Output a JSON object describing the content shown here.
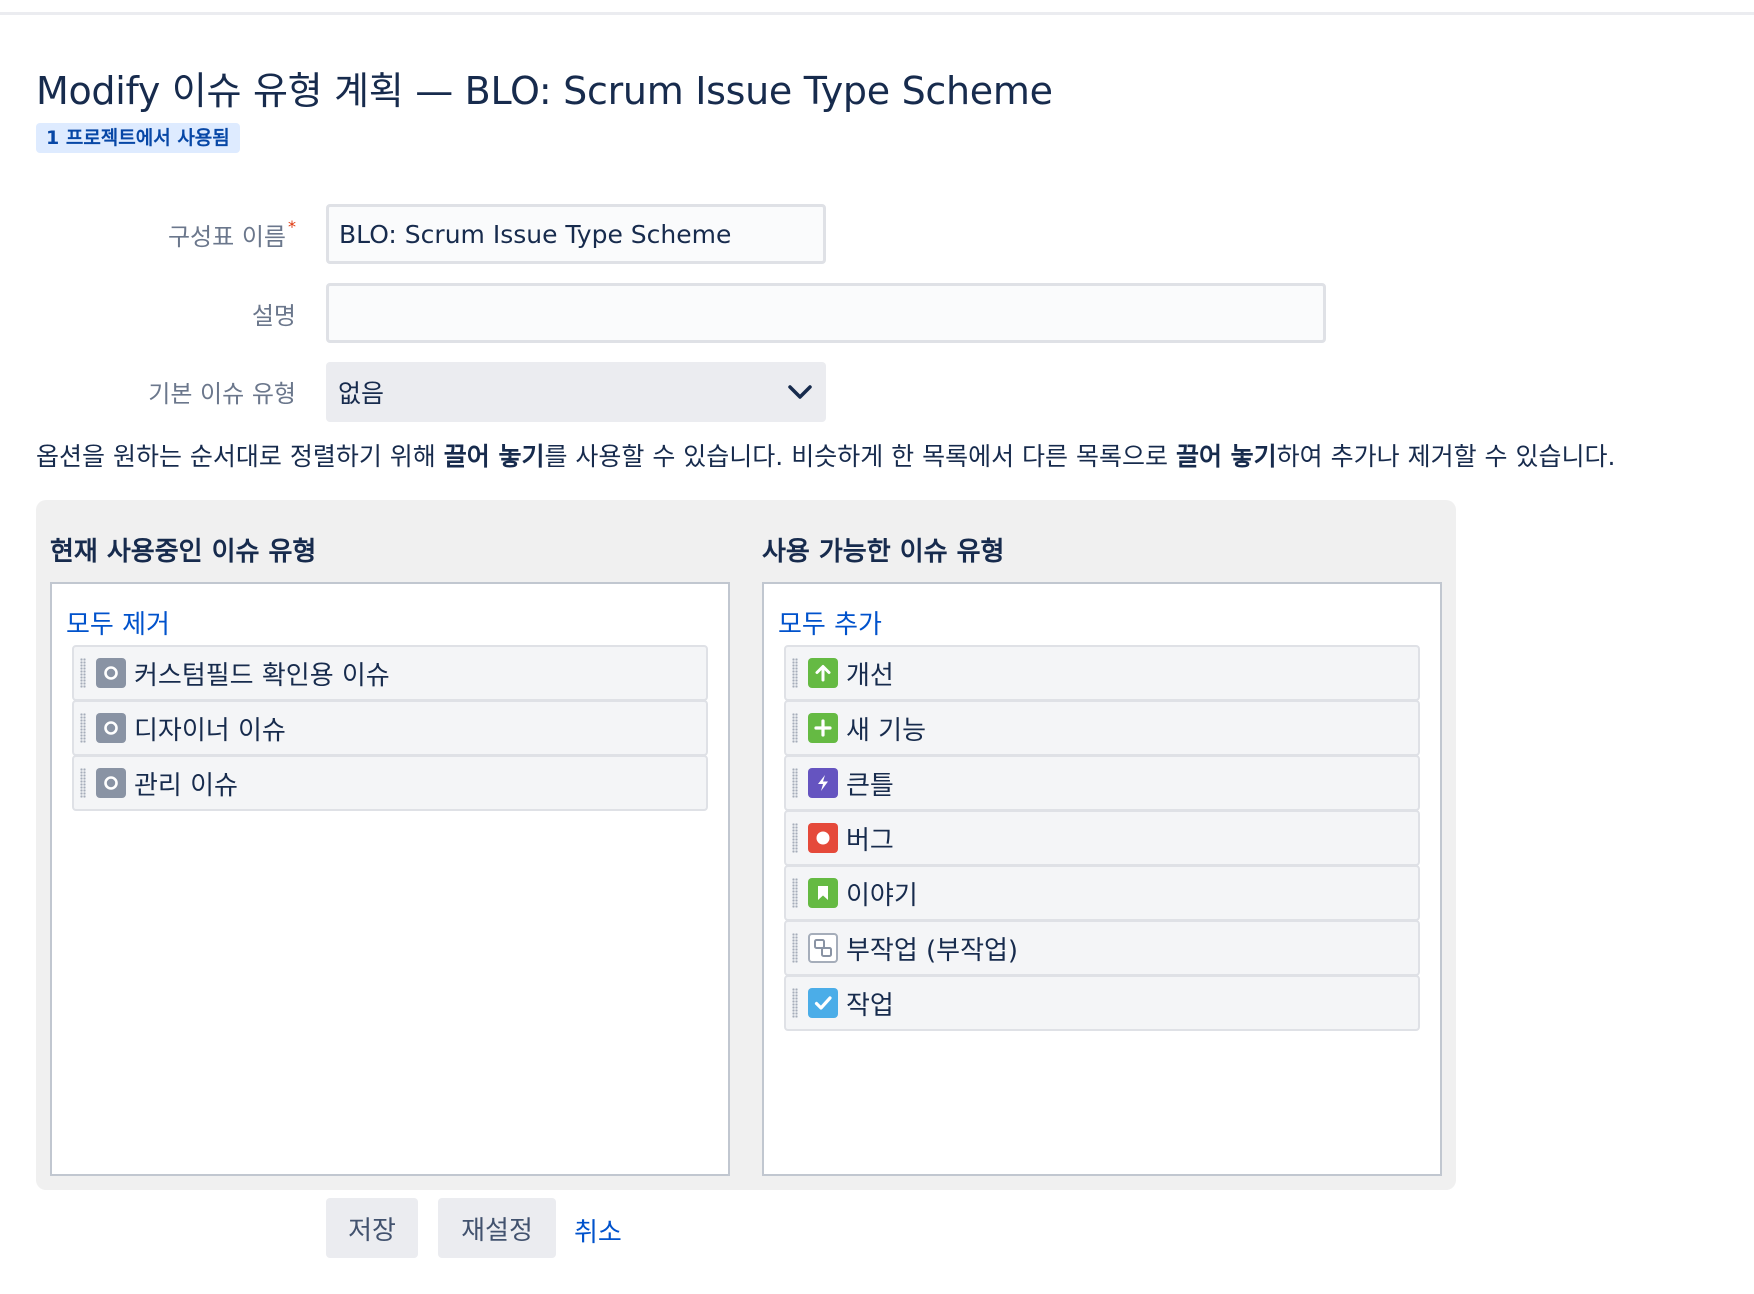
{
  "page": {
    "title": "Modify 이슈 유형 계획 — BLO: Scrum Issue Type Scheme",
    "usage_badge": "1 프로젝트에서 사용됨"
  },
  "form": {
    "scheme_name_label": "구성표 이름",
    "required_marker": "*",
    "scheme_name_value": "BLO: Scrum Issue Type Scheme",
    "description_label": "설명",
    "description_value": "",
    "default_type_label": "기본 이슈 유형",
    "default_type_value": "없음"
  },
  "help": {
    "part1": "옵션을 원하는 순서대로 정렬하기 위해 ",
    "bold1": "끌어 놓기",
    "part2": "를 사용할 수 있습니다. 비슷하게 한 목록에서 다른 목록으로 ",
    "bold2": "끌어 놓기",
    "part3": "하여 추가나 제거할 수 있습니다."
  },
  "current": {
    "title": "현재 사용중인 이슈 유형",
    "action": "모두 제거",
    "items": [
      {
        "label": "커스텀필드 확인용 이슈",
        "icon": "generic-issue-icon",
        "color": "#8993a4"
      },
      {
        "label": "디자이너 이슈",
        "icon": "generic-issue-icon",
        "color": "#8993a4"
      },
      {
        "label": "관리 이슈",
        "icon": "generic-issue-icon",
        "color": "#8993a4"
      }
    ]
  },
  "available": {
    "title": "사용 가능한 이슈 유형",
    "action": "모두 추가",
    "items": [
      {
        "label": "개선",
        "icon": "improvement-icon",
        "color": "#65ba43"
      },
      {
        "label": "새 기능",
        "icon": "new-feature-icon",
        "color": "#65ba43"
      },
      {
        "label": "큰틀",
        "icon": "epic-icon",
        "color": "#6554c0"
      },
      {
        "label": "버그",
        "icon": "bug-icon",
        "color": "#e5493a"
      },
      {
        "label": "이야기",
        "icon": "story-icon",
        "color": "#65ba43"
      },
      {
        "label": "부작업 (부작업)",
        "icon": "subtask-icon",
        "color": "#d9d9d9"
      },
      {
        "label": "작업",
        "icon": "task-icon",
        "color": "#4bade8"
      }
    ]
  },
  "buttons": {
    "save": "저장",
    "reset": "재설정",
    "cancel": "취소"
  }
}
